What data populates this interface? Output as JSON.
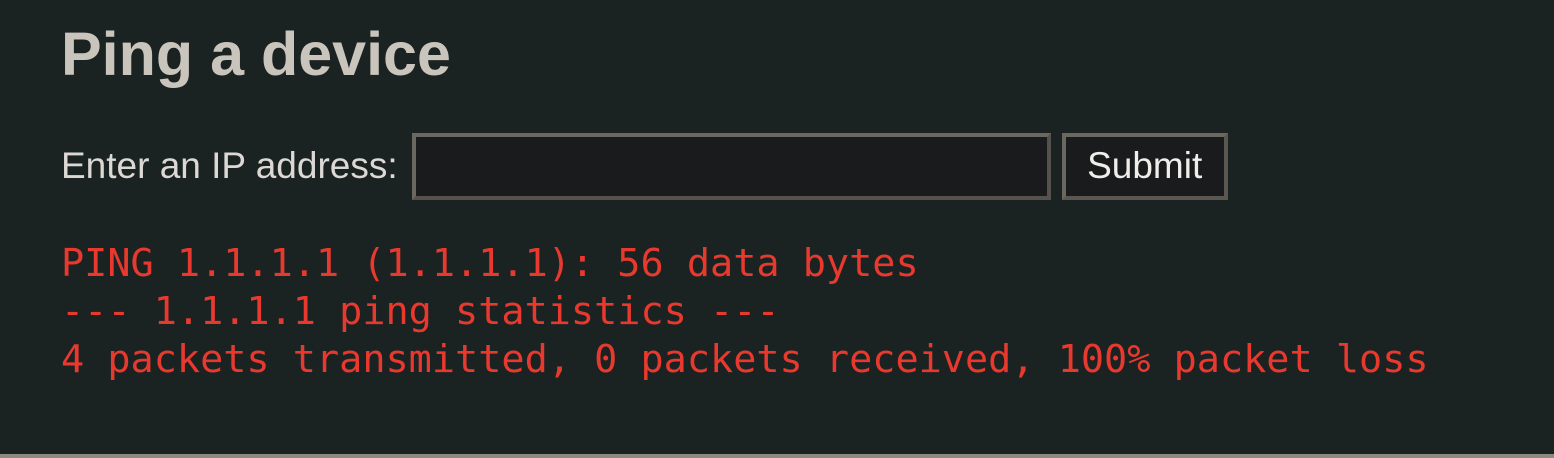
{
  "page": {
    "title": "Ping a device"
  },
  "form": {
    "label": "Enter an IP address:",
    "input_value": "",
    "input_placeholder": "",
    "submit_label": "Submit"
  },
  "output": {
    "lines": [
      "PING 1.1.1.1 (1.1.1.1): 56 data bytes",
      "--- 1.1.1.1 ping statistics ---",
      "4 packets transmitted, 0 packets received, 100% packet loss"
    ]
  },
  "colors": {
    "background": "#1b2222",
    "title_text": "#c9c5bd",
    "output_text": "#e8392e",
    "input_background": "#1a1b1c"
  }
}
